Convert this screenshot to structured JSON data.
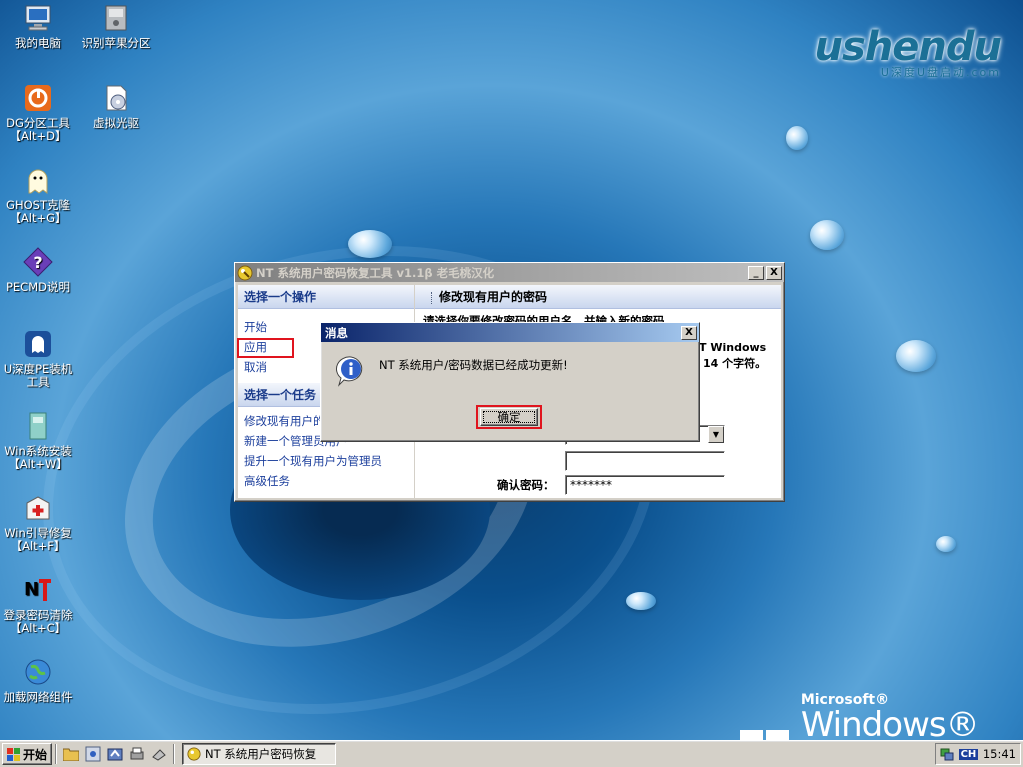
{
  "desktop": {
    "icons": [
      {
        "label": "我的电脑"
      },
      {
        "label": "识别苹果分区"
      },
      {
        "label": "DG分区工具\n【Alt+D】"
      },
      {
        "label": "虚拟光驱"
      },
      {
        "label": "GHOST克隆\n【Alt+G】"
      },
      {
        "label": "PECMD说明"
      },
      {
        "label": "U深度PE装机\n工具"
      },
      {
        "label": "Win系统安装\n【Alt+W】"
      },
      {
        "label": "Win引导修复\n【Alt+F】"
      },
      {
        "label": "登录密码清除\n【Alt+C】"
      },
      {
        "label": "加载网络组件"
      }
    ],
    "logo_main": "ushendu",
    "logo_sub": "U深度U盘启动.com",
    "brand_microsoft": "Microsoft®",
    "brand_winpe": "Windows® PE"
  },
  "main_window": {
    "title": "NT 系统用户密码恢复工具 v1.1β 老毛桃汉化",
    "min_label": "_",
    "close_label": "X",
    "left": {
      "section1_title": "选择一个操作",
      "actions": [
        "开始",
        "应用",
        "取消"
      ],
      "section2_title": "选择一个任务",
      "tasks": [
        "修改现有用户的密码",
        "新建一个管理员用户",
        "提升一个现有用户为管理员",
        "高级任务"
      ]
    },
    "right": {
      "header": "修改现有用户的密码",
      "instruction": "请选择你要修改密码的用户名，并输入新的密码",
      "note_line1": "T Windows",
      "note_line2": "14 个字符。",
      "confirm_label": "确认密码：",
      "confirm_value": "*******"
    }
  },
  "dialog": {
    "title": "消息",
    "close_label": "X",
    "message": "NT 系统用户/密码数据已经成功更新!",
    "ok_label": "确定"
  },
  "taskbar": {
    "start_label": "开始",
    "task_label": "NT 系统用户密码恢复",
    "tray_lang": "CH",
    "clock": "15:41"
  },
  "colors": {
    "highlight_red": "#e0141e",
    "link_blue": "#1c3f9c",
    "active_title": "#0a246a"
  }
}
